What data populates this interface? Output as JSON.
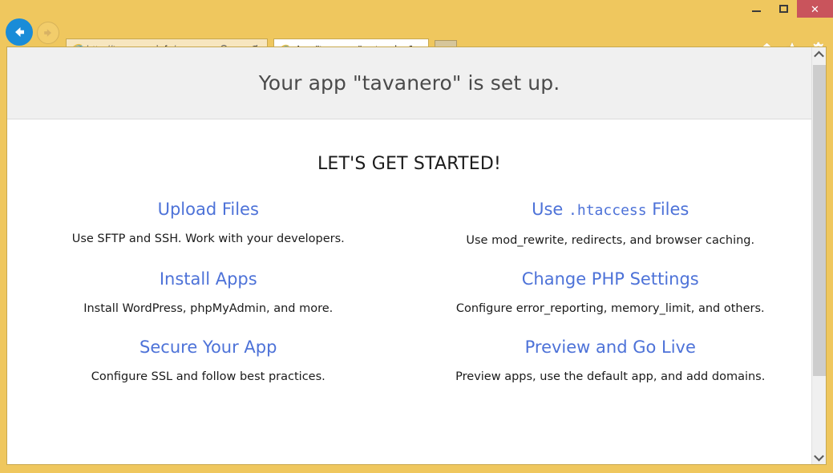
{
  "browser": {
    "window_controls": {
      "minimize_label": "–",
      "maximize_label": "",
      "close_label": "✕"
    },
    "address": {
      "url_scheme": "http://",
      "url_host": "tavanero.info",
      "url_path": "/",
      "url_full": "http://tavanero.info/",
      "search_icon": "search-icon",
      "dropdown_icon": "chevron-down-icon",
      "refresh_icon": "refresh-icon"
    },
    "nav": {
      "back_icon": "back-arrow-icon",
      "forward_icon": "forward-arrow-icon"
    },
    "tab": {
      "title": "App \"tavanero\" set up by S...",
      "close_label": "✕",
      "favicon": "internet-explorer-icon"
    },
    "newtab": {
      "label": ""
    },
    "toolbar": {
      "home_icon": "home-icon",
      "favorites_icon": "star-icon",
      "settings_icon": "gear-icon"
    },
    "scrollbar": {
      "up_arrow": "chevron-up-icon",
      "down_arrow": "chevron-down-icon"
    }
  },
  "page": {
    "banner_heading": "Your app \"tavanero\" is set up.",
    "section_heading": "LET'S GET STARTED!",
    "cards": [
      {
        "title_pre": "Upload Files",
        "title_mono": "",
        "title_post": "",
        "desc": "Use SFTP and SSH. Work with your developers."
      },
      {
        "title_pre": "Use ",
        "title_mono": ".htaccess",
        "title_post": " Files",
        "desc": "Use mod_rewrite, redirects, and browser caching."
      },
      {
        "title_pre": "Install Apps",
        "title_mono": "",
        "title_post": "",
        "desc": "Install WordPress, phpMyAdmin, and more."
      },
      {
        "title_pre": "Change PHP Settings",
        "title_mono": "",
        "title_post": "",
        "desc": "Configure error_reporting, memory_limit, and others."
      },
      {
        "title_pre": "Secure Your App",
        "title_mono": "",
        "title_post": "",
        "desc": "Configure SSL and follow best practices."
      },
      {
        "title_pre": "Preview and Go Live",
        "title_mono": "",
        "title_post": "",
        "desc": "Preview apps, use the default app, and add domains."
      }
    ]
  },
  "colors": {
    "frame": "#efc75e",
    "close_button": "#c9545c",
    "link": "#4d72d8",
    "banner_bg": "#f0f0f0",
    "heading_text": "#4a4a4a"
  }
}
